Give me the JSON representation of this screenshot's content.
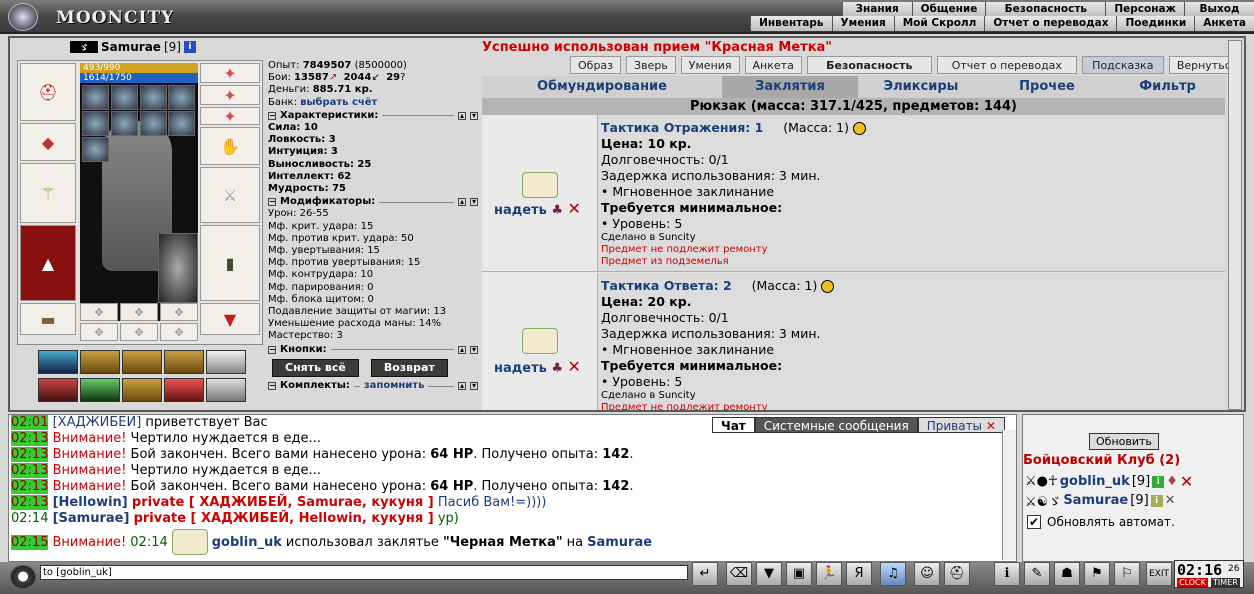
{
  "app": {
    "logo": "MOONCITY"
  },
  "nav": {
    "row1": [
      "Знания",
      "Общение",
      "Безопасность",
      "Персонаж",
      "Выход"
    ],
    "row2": [
      "Инвентарь",
      "Умения",
      "Мой Скролл",
      "Отчет о переводах",
      "Поединки",
      "Анкета"
    ]
  },
  "character": {
    "name": "Samurae",
    "level": "[9]",
    "hp": "493/990",
    "mana": "1614/1750"
  },
  "stats": {
    "exp_label": "Опыт:",
    "exp": "7849507",
    "exp_next": "(8500000)",
    "fights_label": "Бои:",
    "wins": "13587",
    "losses": "2044",
    "draws": "29",
    "money_label": "Деньги:",
    "money": "885.71 кр.",
    "bank_label": "Банк:",
    "bank_link": "выбрать счёт",
    "char_header": "Характеристики:",
    "strength": "Сила: 10",
    "agility": "Ловкость: 3",
    "intuition": "Интуиция: 3",
    "endurance": "Выносливость: 25",
    "intellect": "Интеллект: 62",
    "wisdom": "Мудрость: 75",
    "mods_header": "Модификаторы:",
    "mods": [
      "Урон: 26-55",
      "Мф. крит. удара: 15",
      "Мф. против крит. удара: 50",
      "Мф. увертывания: 15",
      "Мф. против увертывания: 15",
      "Мф. контрудара: 10",
      "Мф. парирования: 0",
      "Мф. блока щитом: 0",
      "Подавление защиты от магии: 13",
      "Уменьшение расхода маны: 14%",
      "Мастерство: 3"
    ],
    "buttons_header": "Кнопки:",
    "undress": "Снять всё",
    "return": "Возврат",
    "sets_header": "Комплекты:",
    "remember": "запомнить"
  },
  "message": "Успешно использован прием \"Красная Метка\"",
  "toptabs": [
    "Образ",
    "Зверь",
    "Умения",
    "Анкета",
    "Безопасность",
    "Отчет о переводах",
    "Подсказка",
    "Вернуться"
  ],
  "invtabs": [
    "Обмундирование",
    "Заклятия",
    "Эликсиры",
    "Прочее",
    "Фильтр"
  ],
  "backpack": "Рюкзак (масса: 317.1/425, предметов: 144)",
  "items": [
    {
      "name": "Тактика Отражения: 1",
      "mass": "(Масса: 1)",
      "price": "Цена: 10 кр.",
      "durability": "Долговечность: 0/1",
      "delay": "Задержка использования: 3 мин.",
      "type": "• Мгновенное заклинание",
      "req": "Требуется минимальное:",
      "lvl": "• Уровень: 5",
      "made": "Сделано в Suncity",
      "norepair": "Предмет не подлежит ремонту",
      "dungeon": "Предмет из подземелья",
      "wear": "надеть"
    },
    {
      "name": "Тактика Ответа: 2",
      "mass": "(Масса: 1)",
      "price": "Цена: 20 кр.",
      "durability": "Долговечность: 0/1",
      "delay": "Задержка использования: 3 мин.",
      "type": "• Мгновенное заклинание",
      "req": "Требуется минимальное:",
      "lvl": "• Уровень: 5",
      "made": "Сделано в Suncity",
      "norepair": "Предмет не подлежит ремонту",
      "wear": "надеть"
    }
  ],
  "chattabs": [
    "Чат",
    "Системные сообщения",
    "Приваты"
  ],
  "chat": [
    {
      "time": "02:01",
      "pre": "[ХАДЖИБЕЙ]",
      "text": " приветствует Вас"
    },
    {
      "time": "02:13",
      "alert": "Внимание!",
      "text": " Чертило нуждается в еде..."
    },
    {
      "time": "02:13",
      "alert": "Внимание!",
      "text": " Бой закончен. Всего вами нанесено урона: ",
      "b1": "64 HP",
      "text2": ". Получено опыта: ",
      "b2": "142",
      "text3": "."
    },
    {
      "time": "02:13",
      "alert": "Внимание!",
      "text": " Чертило нуждается в еде..."
    },
    {
      "time": "02:13",
      "alert": "Внимание!",
      "text": " Бой закончен. Всего вами нанесено урона: ",
      "b1": "64 HP",
      "text2": ". Получено опыта: ",
      "b2": "142",
      "text3": "."
    },
    {
      "time": "02:13",
      "pre": "[Hellowin]",
      "priv": "private [ ХАДЖИБЕЙ, Samurae, кукуня ]",
      "text": " Пасиб Вам!=))))"
    },
    {
      "time": "02:14",
      "pre": "[Samurae]",
      "priv": "private [ ХАДЖИБЕЙ, Hellowin, кукуня ]",
      "text": " ур)"
    },
    {
      "time": "02:15",
      "alert": "Внимание!",
      "time2": "02:14",
      "user": "goblin_uk",
      "text": " использовал заклятье ",
      "spell": "\"Черная Метка\"",
      "text2": " на ",
      "target": "Samurae"
    }
  ],
  "rpanel": {
    "refresh": "Обновить",
    "room": "Бойцовский Клуб (2)",
    "users": [
      {
        "name": "goblin_uk",
        "lvl": "[9]"
      },
      {
        "name": "Samurae",
        "lvl": "[9]"
      }
    ],
    "auto": "Обновлять автомат."
  },
  "input": {
    "value": "to [goblin_uk]"
  },
  "clock": {
    "time": "02:16",
    "sec": "26",
    "clock_label": "CLOCK",
    "timer_label": "TIMER"
  }
}
